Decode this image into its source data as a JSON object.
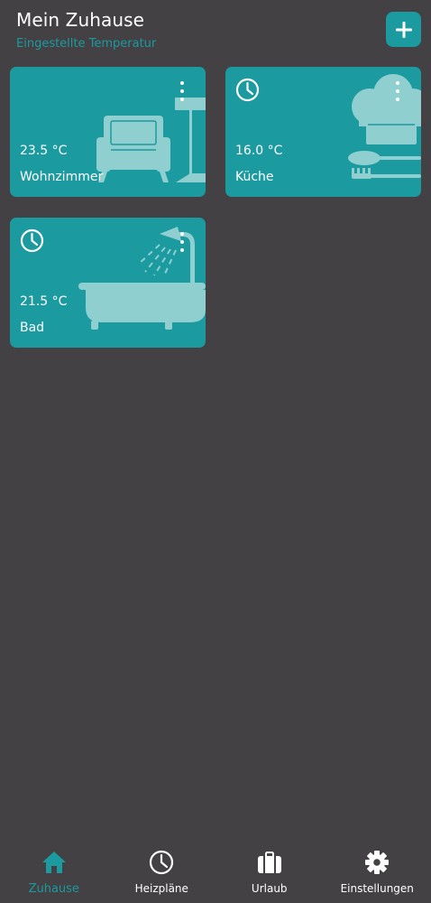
{
  "header": {
    "title": "Mein Zuhause",
    "subtitle": "Eingestellte Temperatur",
    "add_icon": "plus-icon"
  },
  "colors": {
    "background": "#434144",
    "accent": "#1b9aa0",
    "illustration": "#8fcfd0",
    "text": "#ffffff"
  },
  "rooms": [
    {
      "name": "Wohnzimmer",
      "temperature": "23.5 °C",
      "illustration": "armchair-lamp-icon",
      "schedule_icon": false
    },
    {
      "name": "Küche",
      "temperature": "16.0 °C",
      "illustration": "chef-hat-cutlery-icon",
      "schedule_icon": true
    },
    {
      "name": "Bad",
      "temperature": "21.5 °C",
      "illustration": "bathtub-shower-icon",
      "schedule_icon": true
    }
  ],
  "bottom_nav": {
    "items": [
      {
        "label": "Zuhause",
        "icon": "home-icon",
        "active": true
      },
      {
        "label": "Heizpläne",
        "icon": "clock-icon",
        "active": false
      },
      {
        "label": "Urlaub",
        "icon": "suitcase-icon",
        "active": false
      },
      {
        "label": "Einstellungen",
        "icon": "gear-icon",
        "active": false
      }
    ]
  }
}
